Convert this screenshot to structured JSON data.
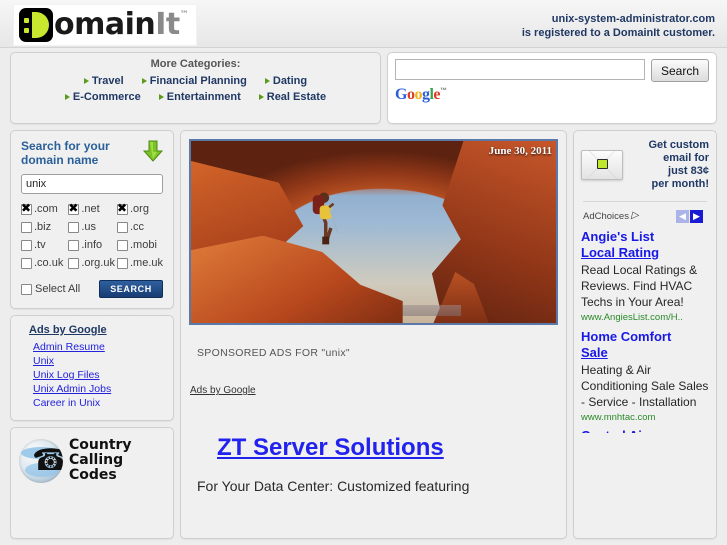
{
  "header": {
    "logo_main": "omain",
    "logo_it": "It",
    "logo_tm": "™",
    "domain_line1": "unix-system-administrator.com",
    "domain_line2": "is registered to a DomainIt customer."
  },
  "categories": {
    "title": "More Categories:",
    "row1": [
      "Travel",
      "Financial Planning",
      "Dating"
    ],
    "row2": [
      "E-Commerce",
      "Entertainment",
      "Real Estate"
    ]
  },
  "google_search": {
    "value": "",
    "placeholder": "",
    "button_label": "Search",
    "logo": {
      "g1": "G",
      "o1": "o",
      "o2": "o",
      "g2": "g",
      "l": "l",
      "e": "e",
      "tm": "™"
    }
  },
  "domain_search": {
    "title": "Search for your domain name",
    "input_value": "unix",
    "placeholder": "",
    "tlds": [
      {
        "label": ".com",
        "checked": true
      },
      {
        "label": ".net",
        "checked": true
      },
      {
        "label": ".org",
        "checked": true
      },
      {
        "label": ".biz",
        "checked": false
      },
      {
        "label": ".us",
        "checked": false
      },
      {
        "label": ".cc",
        "checked": false
      },
      {
        "label": ".tv",
        "checked": false
      },
      {
        "label": ".info",
        "checked": false
      },
      {
        "label": ".mobi",
        "checked": false
      },
      {
        "label": ".co.uk",
        "checked": false
      },
      {
        "label": ".org.uk",
        "checked": false
      },
      {
        "label": ".me.uk",
        "checked": false
      }
    ],
    "select_all_label": "Select All",
    "select_all_checked": false,
    "search_button": "SEARCH"
  },
  "left_ads": {
    "header": "Ads by Google",
    "links": [
      "Admin Resume",
      "Unix",
      "Unix Log Files",
      "Unix Admin Jobs",
      "Career in Unix"
    ]
  },
  "country_codes_ad": {
    "line1": "Country",
    "line2": "Calling",
    "line3": "Codes",
    "icon": "globe-phone-icon"
  },
  "center": {
    "photo_date": "June 30, 2011",
    "photo_alt": "hiker-under-rock-arch-photo",
    "sponsored_label": "SPONSORED ADS FOR \"unix\"",
    "ads_by_google": "Ads by Google",
    "ad_title": "ZT Server Solutions",
    "ad_desc": "For Your Data Center: Customized featuring"
  },
  "right": {
    "email_ad": {
      "line1": "Get custom",
      "line2": "email for",
      "line3": "just 83¢",
      "line4": "per month!",
      "icon": "envelope-icon"
    },
    "adchoices_label": "AdChoices",
    "nav_prev": "◀",
    "nav_next": "▶",
    "ads": [
      {
        "title_line1": "Angie's List",
        "title_line2": "Local Rating",
        "body": "Read Local Ratings & Reviews. Find HVAC Techs in Your Area!",
        "url": "www.AngiesList.com/H.."
      },
      {
        "title_line1": "Home Comfort",
        "title_line2": "Sale",
        "body": "Heating & Air Conditioning Sale Sales - Service - Installation",
        "url": "www.mnhtac.com"
      }
    ],
    "partial_ad_title": "Central Air"
  },
  "colors": {
    "brand_navy": "#1f3864",
    "link_blue": "#2222ee",
    "accent_green": "#c8e830",
    "url_green": "#2a8a2a",
    "panel_bg": "#f0f0f0",
    "page_bg": "#ededed"
  }
}
